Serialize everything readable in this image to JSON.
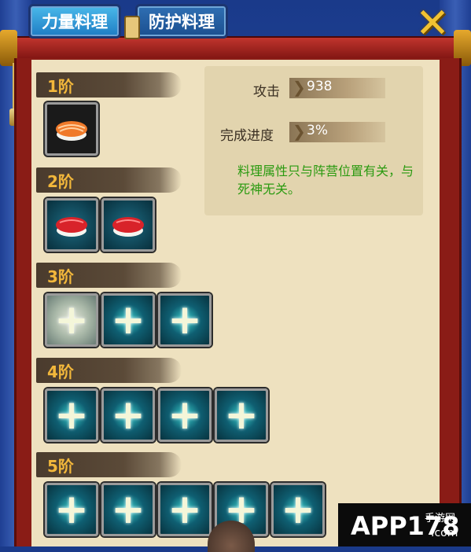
{
  "tabs": [
    {
      "label": "力量料理",
      "active": true
    },
    {
      "label": "防护料理",
      "active": false
    }
  ],
  "close_icon": "close-x-icon",
  "tiers": [
    {
      "label": "1阶",
      "slots": [
        "sushi-salmon"
      ]
    },
    {
      "label": "2阶",
      "slots": [
        "sushi-tuna",
        "sushi-tuna"
      ]
    },
    {
      "label": "3阶",
      "slots": [
        "empty-highlight",
        "empty",
        "empty"
      ]
    },
    {
      "label": "4阶",
      "slots": [
        "empty",
        "empty",
        "empty",
        "empty"
      ]
    },
    {
      "label": "5阶",
      "slots": [
        "empty",
        "empty",
        "empty",
        "empty",
        "empty"
      ]
    }
  ],
  "info": {
    "attack_label": "攻击",
    "attack_value": "938",
    "progress_label": "完成进度",
    "progress_value": "3%",
    "note": "料理属性只与阵营位置有关，与死神无关。"
  },
  "watermark": {
    "main": "APP178",
    "sub": "手游网",
    "domain": ".com"
  },
  "colors": {
    "tier_label": "#f2b73b",
    "note": "#2a9a10",
    "tab_active": "#1e7cc4"
  }
}
